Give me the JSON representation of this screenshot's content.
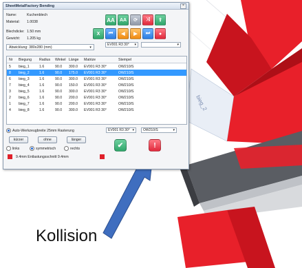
{
  "window": {
    "title": "SheetMetalFactory Bending"
  },
  "info": {
    "name_label": "Name:",
    "name_value": "Kuchenblech",
    "material_label": "Material:",
    "material_value": "1.0038",
    "thickness_label": "Blechdicke:",
    "thickness_value": "1.50 mm",
    "weight_label": "Gewicht:",
    "weight_value": "1.205 kg",
    "unfold_label": "Abwicklung: 380x280 (mm)"
  },
  "toolbar": {
    "aa_large": "AA",
    "aa_small": "AA",
    "matrize_combo": "EV001 R3 30°"
  },
  "table": {
    "headers": [
      "Nr",
      "Biegung",
      "Radius",
      "Winkel",
      "Länge",
      "Matrize",
      "Stempel"
    ],
    "rows": [
      [
        "5",
        "bieg_1",
        "1.6",
        "90.0",
        "300.0",
        "EV001 R3 30°",
        "OW210/S"
      ],
      [
        "8",
        "bieg_2",
        "1.6",
        "90.0",
        "175.0",
        "EV001 R3 30°",
        "OW210/S"
      ],
      [
        "6",
        "bieg_3",
        "1.6",
        "90.0",
        "300.0",
        "EV001 R3 30°",
        "OW210/S"
      ],
      [
        "7",
        "bieg_4",
        "1.6",
        "90.0",
        "150.0",
        "EV001 R3 30°",
        "OW210/S"
      ],
      [
        "3",
        "bieg_5",
        "1.6",
        "90.0",
        "300.0",
        "EV001 R3 30°",
        "OW210/S"
      ],
      [
        "2",
        "bieg_6",
        "1.6",
        "90.0",
        "200.0",
        "EV001 R3 30°",
        "OW210/S"
      ],
      [
        "1",
        "bieg_7",
        "1.6",
        "90.0",
        "200.0",
        "EV001 R3 30°",
        "OW210/S"
      ],
      [
        "4",
        "bieg_8",
        "1.6",
        "90.0",
        "300.0",
        "EV001 R3 30°",
        "OW210/S"
      ]
    ],
    "selected_row": 1
  },
  "bottom": {
    "auto_label": "Auto-Werkzeugbreite 25mm Rasterung",
    "matrize_value": "EV001 R3 30°",
    "stempel_value": "OW210/S",
    "shorter": "kürzer",
    "none": "ohne",
    "longer": "länger",
    "left": "links",
    "symmetric": "symmetrisch",
    "right": "rechts",
    "relief_text": "9.4mm  Entlastungsschnitt 9.4mm"
  },
  "scene": {
    "label": "bieg_2",
    "annotation": "Kollision"
  },
  "colors": {
    "sheet_red": "#e8202a",
    "arrow_blue": "#3f6ebf",
    "selection": "#3399ff"
  }
}
